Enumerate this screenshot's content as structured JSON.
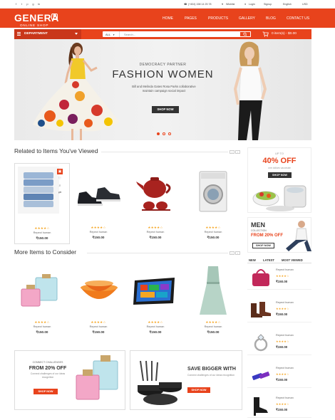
{
  "topbar": {
    "phone": "(+404) 158 14 25 78",
    "wishlist": "Wishlist",
    "login": "Login",
    "signup": "Signup",
    "language": "English",
    "currency": "USD"
  },
  "brand": {
    "name": "GENERA",
    "tagline": "ONLINE SHOP",
    "badge": "G"
  },
  "nav": [
    "HOME",
    "PAGES",
    "PRODUCTS",
    "GALLERY",
    "BLOG",
    "CONTACT US"
  ],
  "search": {
    "department_label": "DEPARTMENT",
    "category": "ALL",
    "placeholder": "Search..."
  },
  "cart": {
    "label": "0 item(s) - $0.00"
  },
  "hero": {
    "kicker": "DEMOCRACY PARTNER",
    "title": "FASHION WOMEN",
    "desc": "Bill and Melinda Gates Rosa Parks collaborative maintain campaign social impact",
    "button": "SHOP NOW"
  },
  "sections": {
    "related_title": "Related to Items You've Viewed",
    "more_title": "More Items to Consider"
  },
  "related_products": [
    {
      "stars": "★★★★☆",
      "title": "Repect human",
      "price": "₹150.00",
      "image": "shirts"
    },
    {
      "stars": "★★★★☆",
      "title": "Repect human",
      "price": "₹150.00",
      "image": "sneakers"
    },
    {
      "stars": "★★★★☆",
      "title": "Repect human",
      "price": "₹150.00",
      "image": "teapot"
    },
    {
      "stars": "★★★★☆",
      "title": "Repect human",
      "price": "₹150.00",
      "image": "washer"
    }
  ],
  "more_products": [
    {
      "stars": "★★★★☆",
      "title": "Repect human",
      "price": "₹150.00",
      "image": "perfume"
    },
    {
      "stars": "★★★★☆",
      "title": "Repect human",
      "price": "₹150.00",
      "image": "bowls"
    },
    {
      "stars": "★★★★☆",
      "title": "Repect human",
      "price": "₹150.00",
      "image": "tablet"
    },
    {
      "stars": "★★★★☆",
      "title": "Repect human",
      "price": "₹150.00",
      "image": "dress"
    }
  ],
  "promo1": {
    "kicker": "UP TO",
    "headline": "40% OFF",
    "sub": "one dollars vaccinate",
    "button": "SHOP NOW"
  },
  "promo2": {
    "line1": "MEN",
    "line2": "COLLECTION",
    "headline": "FROM 20% OFF",
    "button": "SHOP NOW"
  },
  "tabs": [
    "NEW",
    "LATEST",
    "MOST VIEWED"
  ],
  "mini_products": [
    {
      "title": "Repect human",
      "stars": "★★★★☆",
      "price": "₹150.00",
      "image": "handbag"
    },
    {
      "title": "Repect human",
      "stars": "★★★★☆",
      "price": "₹150.00",
      "image": "boots"
    },
    {
      "title": "Repect human",
      "stars": "★★★★☆",
      "price": "₹150.00",
      "image": "ring"
    },
    {
      "title": "Repect human",
      "stars": "★★★★☆",
      "price": "₹150.00",
      "image": "usb"
    },
    {
      "title": "Repect human",
      "stars": "★★★★☆",
      "price": "₹150.00",
      "image": "heels"
    }
  ],
  "banner1": {
    "kicker": "CONNECT CHALLENGES",
    "headline": "FROM 20% OFF",
    "sub": "Connect challenges of our ideas recognition",
    "button": "SHOP NOW"
  },
  "banner2": {
    "headline": "SAVE BIGGER WITH",
    "sub": "Connect challenges of our ideas recognition",
    "button": "SHOP NOW"
  },
  "colors": {
    "accent": "#e8431c",
    "dark": "#333333",
    "star": "#f5a623"
  }
}
